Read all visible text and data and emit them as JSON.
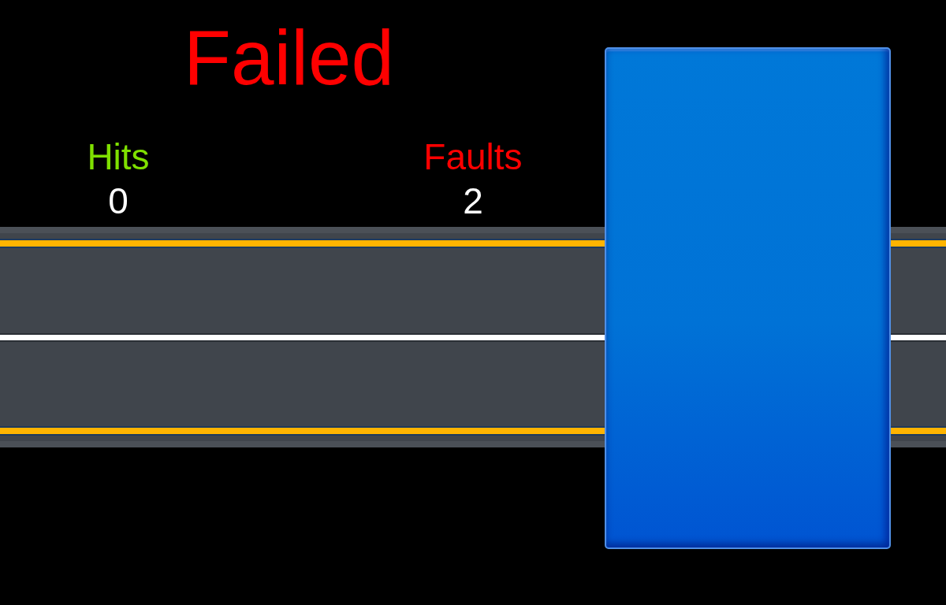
{
  "status": {
    "text": "Failed"
  },
  "scores": [
    {
      "label": "Hits",
      "value": "0",
      "color": "#7fe000"
    },
    {
      "label": "Faults",
      "value": "2",
      "color": "#ff0000"
    }
  ]
}
